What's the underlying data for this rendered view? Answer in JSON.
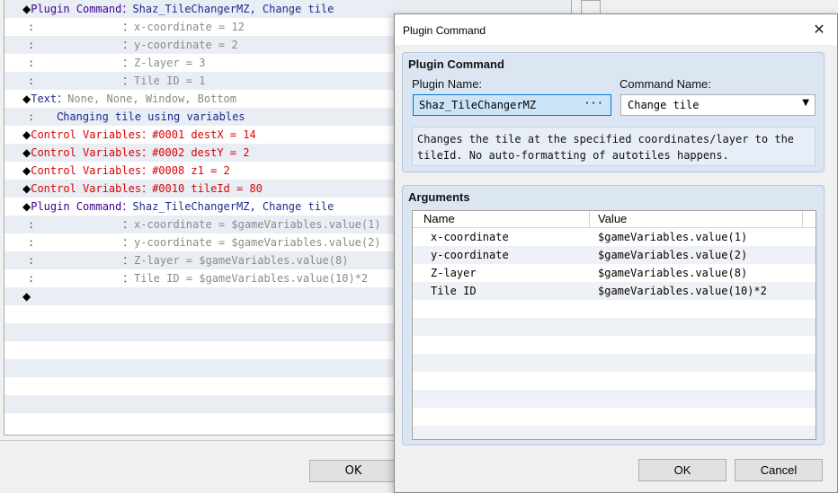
{
  "background_editor": {
    "rows": [
      {
        "kind": "cmd",
        "name": "Plugin Command",
        "name_color": "purple",
        "sep": "：",
        "text": "Shaz_TileChangerMZ, Change tile",
        "text_color": "navy"
      },
      {
        "kind": "cont",
        "text": "x-coordinate = 12"
      },
      {
        "kind": "cont",
        "text": "y-coordinate = 2"
      },
      {
        "kind": "cont",
        "text": "Z-layer = 3"
      },
      {
        "kind": "cont",
        "text": "Tile ID = 1"
      },
      {
        "kind": "cmd",
        "name": "Text",
        "name_color": "navy",
        "sep": "：",
        "text": "None, None, Window, Bottom",
        "text_color": "gray"
      },
      {
        "kind": "cont2",
        "text": "Changing tile using variables"
      },
      {
        "kind": "cmd",
        "name": "Control Variables",
        "name_color": "red",
        "sep": "：",
        "text": "#0001 destX = 14",
        "text_color": "red"
      },
      {
        "kind": "cmd",
        "name": "Control Variables",
        "name_color": "red",
        "sep": "：",
        "text": "#0002 destY = 2",
        "text_color": "red"
      },
      {
        "kind": "cmd",
        "name": "Control Variables",
        "name_color": "red",
        "sep": "：",
        "text": "#0008 z1 = 2",
        "text_color": "red"
      },
      {
        "kind": "cmd",
        "name": "Control Variables",
        "name_color": "red",
        "sep": "：",
        "text": "#0010 tileId = 80",
        "text_color": "red"
      },
      {
        "kind": "cmd",
        "name": "Plugin Command",
        "name_color": "purple",
        "sep": "：",
        "text": "Shaz_TileChangerMZ, Change tile",
        "text_color": "navy"
      },
      {
        "kind": "cont",
        "text": "x-coordinate = $gameVariables.value(1)"
      },
      {
        "kind": "cont",
        "text": "y-coordinate = $gameVariables.value(2)"
      },
      {
        "kind": "cont",
        "text": "Z-layer = $gameVariables.value(8)"
      },
      {
        "kind": "cont",
        "text": "Tile ID = $gameVariables.value(10)*2"
      },
      {
        "kind": "end",
        "text": ""
      }
    ],
    "colon": "：",
    "ok_label": "OK"
  },
  "dialog": {
    "title": "Plugin Command",
    "close_glyph": "✕",
    "plugin_group_title": "Plugin Command",
    "plugin_name_label": "Plugin Name:",
    "plugin_name_value": "Shaz_TileChangerMZ",
    "plugin_name_dots": "···",
    "command_name_label": "Command Name:",
    "command_name_value": "Change tile",
    "description": "Changes the tile at the specified coordinates/layer to the tileId. No auto-formatting of autotiles happens.",
    "arguments_title": "Arguments",
    "columns": [
      "Name",
      "Value"
    ],
    "arguments": [
      {
        "name": "x-coordinate",
        "value": "$gameVariables.value(1)"
      },
      {
        "name": "y-coordinate",
        "value": "$gameVariables.value(2)"
      },
      {
        "name": "Z-layer",
        "value": "$gameVariables.value(8)"
      },
      {
        "name": "Tile ID",
        "value": "$gameVariables.value(10)*2"
      }
    ],
    "ok_label": "OK",
    "cancel_label": "Cancel"
  },
  "colors": {
    "purple": "#3f008f",
    "navy": "#1f2a8f",
    "red": "#dd0000",
    "gray": "#8a8a8a",
    "accent": "#0078d7"
  }
}
